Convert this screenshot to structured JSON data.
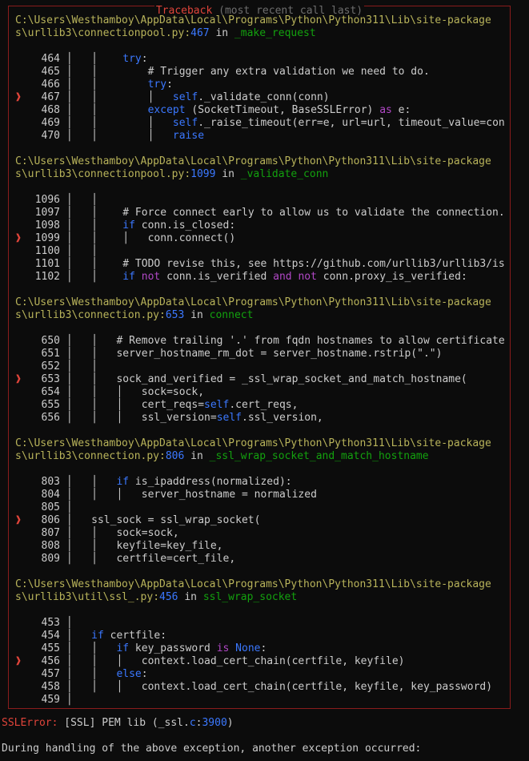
{
  "traceback": {
    "title_main": "Traceback",
    "title_sub": "(most recent call last)",
    "frames": [
      {
        "path_line1": "C:\\Users\\Westhamboy\\AppData\\Local\\Programs\\Python\\Python311\\Lib\\site-package",
        "path_line2": "s\\urllib3\\connectionpool.py",
        "lineno": "467",
        "in_word": "in",
        "func": "_make_request",
        "lines": [
          {
            "n": "464",
            "arrow": "",
            "guides": "│   │    ",
            "code": [
              [
                "kw",
                "try"
              ],
              [
                "t",
                ":"
              ]
            ]
          },
          {
            "n": "465",
            "arrow": "",
            "guides": "│   │    ",
            "code": [
              [
                "t",
                "    # Trigger any extra validation we need to do."
              ]
            ]
          },
          {
            "n": "466",
            "arrow": "",
            "guides": "│   │    ",
            "code": [
              [
                "t",
                "    "
              ],
              [
                "kw",
                "try"
              ],
              [
                "t",
                ":"
              ]
            ]
          },
          {
            "n": "467",
            "arrow": "❱",
            "guides": "│   │    ",
            "code": [
              [
                "t",
                "    │   "
              ],
              [
                "kw",
                "self"
              ],
              [
                "t",
                "._validate_conn(conn)"
              ]
            ]
          },
          {
            "n": "468",
            "arrow": "",
            "guides": "│   │    ",
            "code": [
              [
                "t",
                "    "
              ],
              [
                "kw",
                "except"
              ],
              [
                "t",
                " (SocketTimeout, BaseSSLError) "
              ],
              [
                "kw2",
                "as"
              ],
              [
                "t",
                " e:"
              ]
            ]
          },
          {
            "n": "469",
            "arrow": "",
            "guides": "│   │    ",
            "code": [
              [
                "t",
                "    │   "
              ],
              [
                "kw",
                "self"
              ],
              [
                "t",
                "._raise_timeout(err=e, url=url, timeout_value=con"
              ]
            ]
          },
          {
            "n": "470",
            "arrow": "",
            "guides": "│   │    ",
            "code": [
              [
                "t",
                "    │   "
              ],
              [
                "kw",
                "raise"
              ]
            ]
          }
        ]
      },
      {
        "path_line1": "C:\\Users\\Westhamboy\\AppData\\Local\\Programs\\Python\\Python311\\Lib\\site-package",
        "path_line2": "s\\urllib3\\connectionpool.py",
        "lineno": "1099",
        "in_word": "in",
        "func": "_validate_conn",
        "lines": [
          {
            "n": "1096",
            "arrow": "",
            "guides": "│   │    ",
            "code": [
              [
                "t",
                ""
              ]
            ]
          },
          {
            "n": "1097",
            "arrow": "",
            "guides": "│   │    ",
            "code": [
              [
                "t",
                "# Force connect early to allow us to validate the connection."
              ]
            ]
          },
          {
            "n": "1098",
            "arrow": "",
            "guides": "│   │    ",
            "code": [
              [
                "kw",
                "if"
              ],
              [
                "t",
                " conn.is_closed:"
              ]
            ]
          },
          {
            "n": "1099",
            "arrow": "❱",
            "guides": "│   │    ",
            "code": [
              [
                "t",
                "│   conn.connect()"
              ]
            ]
          },
          {
            "n": "1100",
            "arrow": "",
            "guides": "│   │    ",
            "code": [
              [
                "t",
                ""
              ]
            ]
          },
          {
            "n": "1101",
            "arrow": "",
            "guides": "│   │    ",
            "code": [
              [
                "t",
                "# TODO revise this, see https://github.com/urllib3/urllib3/is"
              ]
            ]
          },
          {
            "n": "1102",
            "arrow": "",
            "guides": "│   │    ",
            "code": [
              [
                "kw",
                "if"
              ],
              [
                "t",
                " "
              ],
              [
                "kw2",
                "not"
              ],
              [
                "t",
                " conn.is_verified "
              ],
              [
                "kw2",
                "and"
              ],
              [
                "t",
                " "
              ],
              [
                "kw2",
                "not"
              ],
              [
                "t",
                " conn.proxy_is_verified:"
              ]
            ]
          }
        ]
      },
      {
        "path_line1": "C:\\Users\\Westhamboy\\AppData\\Local\\Programs\\Python\\Python311\\Lib\\site-package",
        "path_line2": "s\\urllib3\\connection.py",
        "lineno": "653",
        "in_word": "in",
        "func": "connect",
        "lines": [
          {
            "n": "650",
            "arrow": "",
            "guides": "│   │   ",
            "code": [
              [
                "t",
                "# Remove trailing '.' from fqdn hostnames to allow certificate"
              ]
            ]
          },
          {
            "n": "651",
            "arrow": "",
            "guides": "│   │   ",
            "code": [
              [
                "t",
                "server_hostname_rm_dot = server_hostname.rstrip(\".\")"
              ]
            ]
          },
          {
            "n": "652",
            "arrow": "",
            "guides": "│   │   ",
            "code": [
              [
                "t",
                ""
              ]
            ]
          },
          {
            "n": "653",
            "arrow": "❱",
            "guides": "│   │   ",
            "code": [
              [
                "t",
                "sock_and_verified = _ssl_wrap_socket_and_match_hostname("
              ]
            ]
          },
          {
            "n": "654",
            "arrow": "",
            "guides": "│   │   ",
            "code": [
              [
                "t",
                "│   sock=sock,"
              ]
            ]
          },
          {
            "n": "655",
            "arrow": "",
            "guides": "│   │   ",
            "code": [
              [
                "t",
                "│   cert_reqs="
              ],
              [
                "kw",
                "self"
              ],
              [
                "t",
                ".cert_reqs,"
              ]
            ]
          },
          {
            "n": "656",
            "arrow": "",
            "guides": "│   │   ",
            "code": [
              [
                "t",
                "│   ssl_version="
              ],
              [
                "kw",
                "self"
              ],
              [
                "t",
                ".ssl_version,"
              ]
            ]
          }
        ]
      },
      {
        "path_line1": "C:\\Users\\Westhamboy\\AppData\\Local\\Programs\\Python\\Python311\\Lib\\site-package",
        "path_line2": "s\\urllib3\\connection.py",
        "lineno": "806",
        "in_word": "in",
        "func": "_ssl_wrap_socket_and_match_hostname",
        "lines": [
          {
            "n": "803",
            "arrow": "",
            "guides": "│   │   ",
            "code": [
              [
                "kw",
                "if"
              ],
              [
                "t",
                " is_ipaddress(normalized):"
              ]
            ]
          },
          {
            "n": "804",
            "arrow": "",
            "guides": "│   │   ",
            "code": [
              [
                "t",
                "│   server_hostname = normalized"
              ]
            ]
          },
          {
            "n": "805",
            "arrow": "",
            "guides": "│       ",
            "code": [
              [
                "t",
                ""
              ]
            ]
          },
          {
            "n": "806",
            "arrow": "❱",
            "guides": "│   ",
            "code": [
              [
                "t",
                "ssl_sock = ssl_wrap_socket("
              ]
            ]
          },
          {
            "n": "807",
            "arrow": "",
            "guides": "│   ",
            "code": [
              [
                "t",
                "│   sock=sock,"
              ]
            ]
          },
          {
            "n": "808",
            "arrow": "",
            "guides": "│   ",
            "code": [
              [
                "t",
                "│   keyfile=key_file,"
              ]
            ]
          },
          {
            "n": "809",
            "arrow": "",
            "guides": "│   ",
            "code": [
              [
                "t",
                "│   certfile=cert_file,"
              ]
            ]
          }
        ]
      },
      {
        "path_line1": "C:\\Users\\Westhamboy\\AppData\\Local\\Programs\\Python\\Python311\\Lib\\site-package",
        "path_line2": "s\\urllib3\\util\\ssl_.py",
        "lineno": "456",
        "in_word": "in",
        "func": "ssl_wrap_socket",
        "lines": [
          {
            "n": "453",
            "arrow": "",
            "guides": "│   ",
            "code": [
              [
                "t",
                ""
              ]
            ]
          },
          {
            "n": "454",
            "arrow": "",
            "guides": "│   ",
            "code": [
              [
                "kw",
                "if"
              ],
              [
                "t",
                " certfile:"
              ]
            ]
          },
          {
            "n": "455",
            "arrow": "",
            "guides": "│   ",
            "code": [
              [
                "t",
                "│   "
              ],
              [
                "kw",
                "if"
              ],
              [
                "t",
                " key_password "
              ],
              [
                "kw2",
                "is"
              ],
              [
                "t",
                " "
              ],
              [
                "kw",
                "None"
              ],
              [
                "t",
                ":"
              ]
            ]
          },
          {
            "n": "456",
            "arrow": "❱",
            "guides": "│   ",
            "code": [
              [
                "t",
                "│   │   context.load_cert_chain(certfile, keyfile)"
              ]
            ]
          },
          {
            "n": "457",
            "arrow": "",
            "guides": "│   ",
            "code": [
              [
                "t",
                "│   "
              ],
              [
                "kw",
                "else"
              ],
              [
                "t",
                ":"
              ]
            ]
          },
          {
            "n": "458",
            "arrow": "",
            "guides": "│   ",
            "code": [
              [
                "t",
                "│   │   context.load_cert_chain(certfile, keyfile, key_password)"
              ]
            ]
          },
          {
            "n": "459",
            "arrow": "",
            "guides": "│   ",
            "code": [
              [
                "t",
                ""
              ]
            ]
          }
        ]
      }
    ]
  },
  "error": {
    "type": "SSLError:",
    "message_pre": " [SSL] PEM lib (_ssl.",
    "message_c": "c",
    "message_colon": ":",
    "message_num": "3900",
    "message_post": ")"
  },
  "during": "During handling of the above exception, another exception occurred:"
}
